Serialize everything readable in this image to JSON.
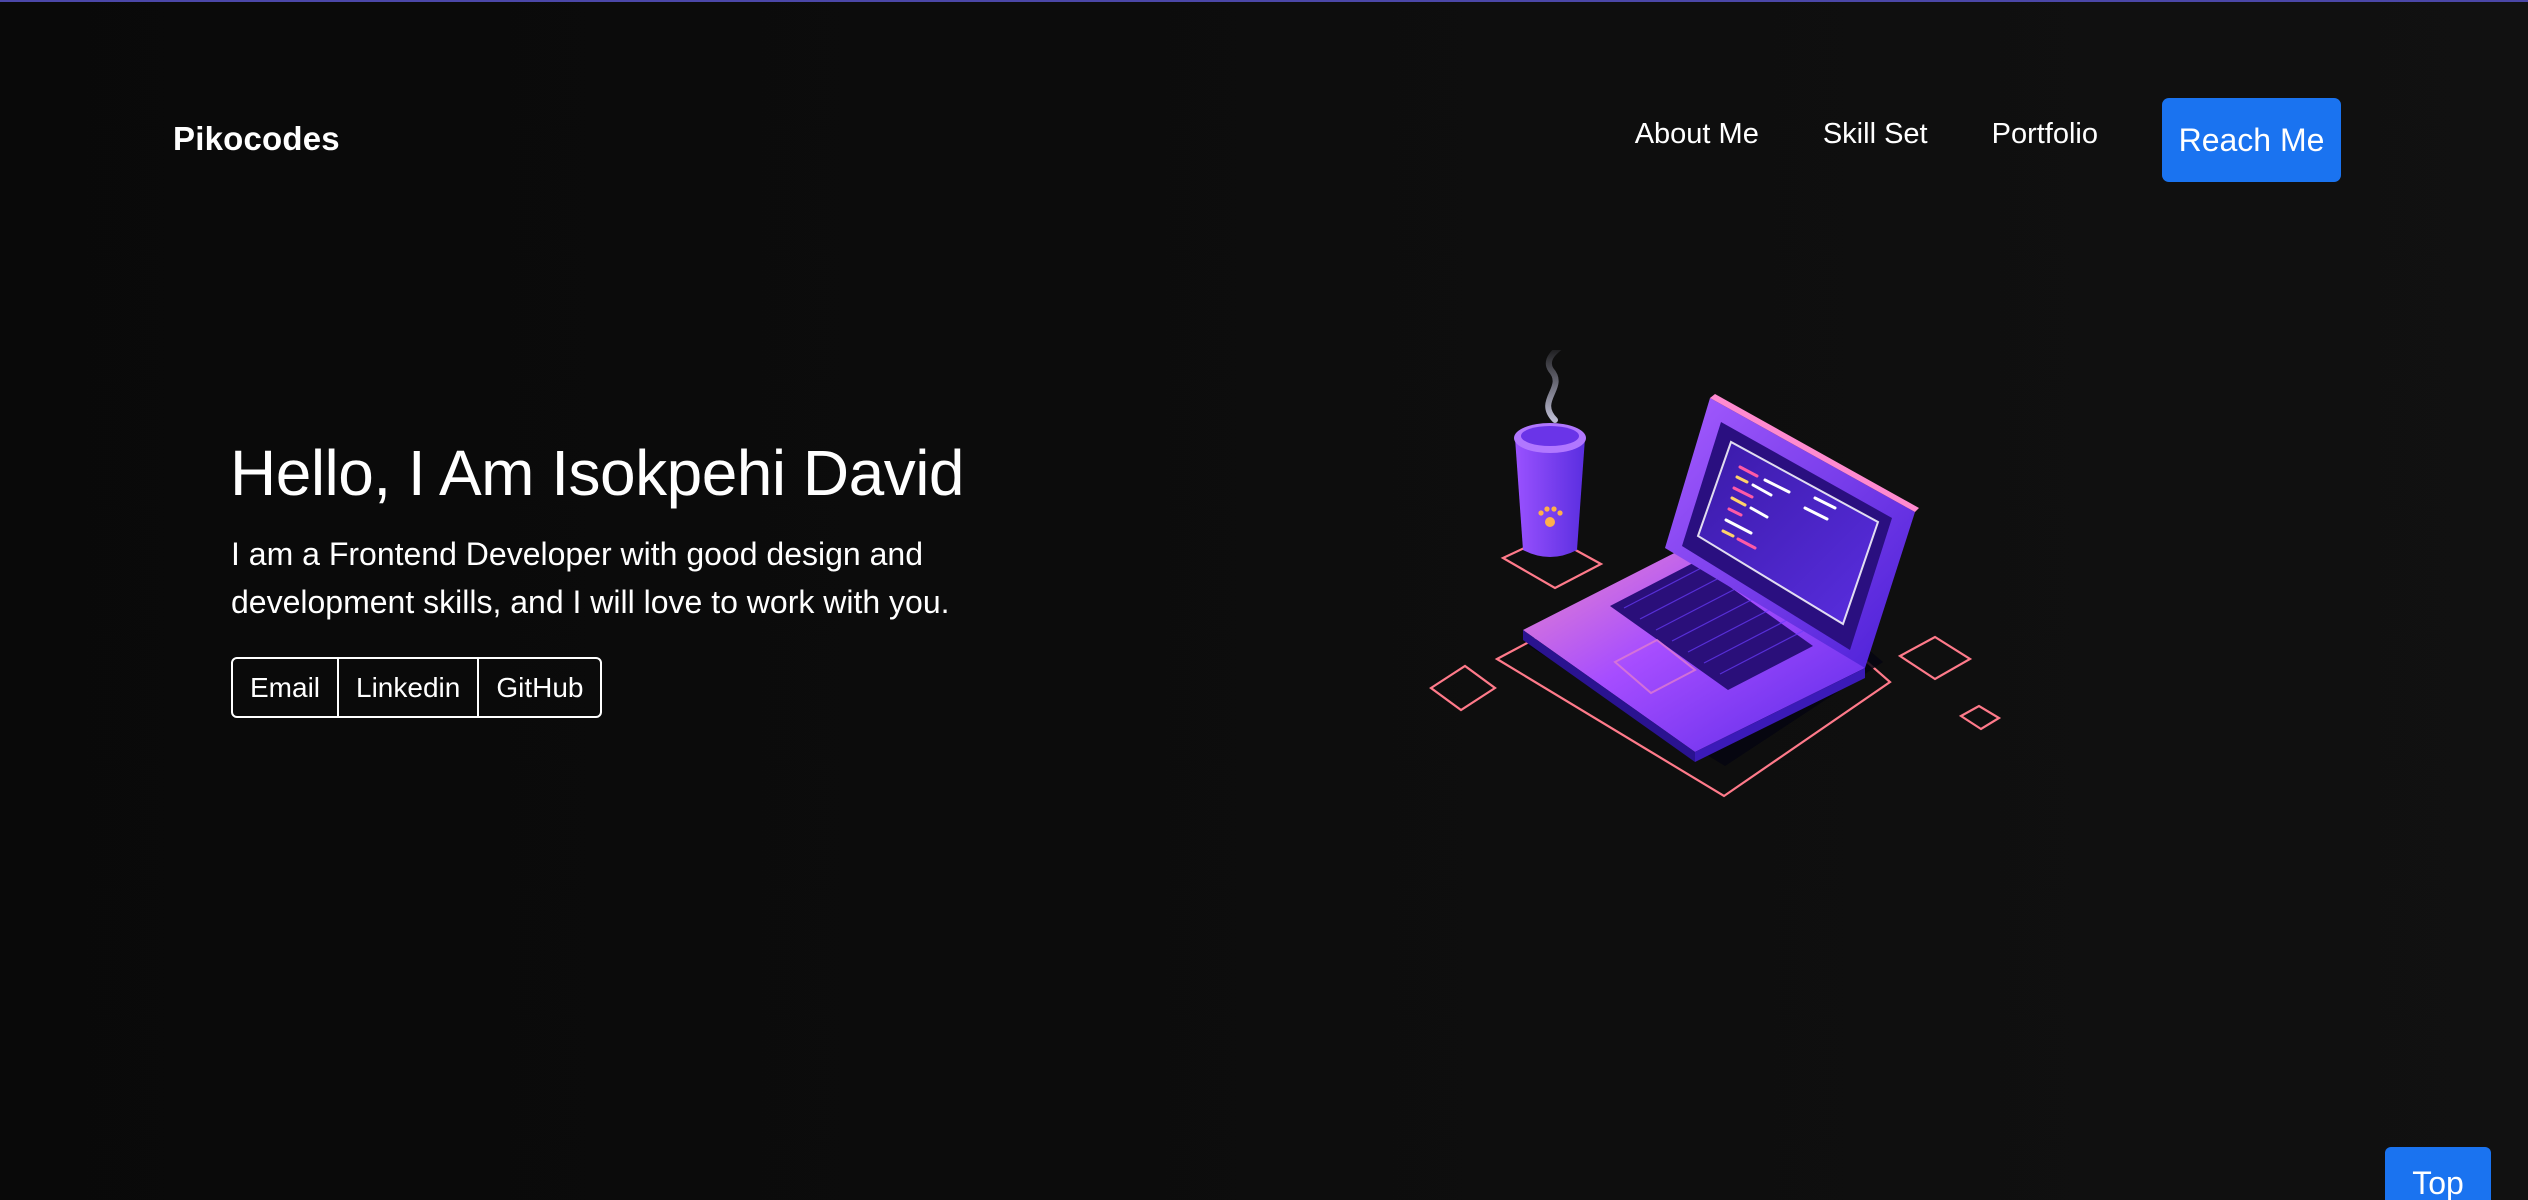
{
  "header": {
    "brand": "Pikocodes",
    "nav": {
      "about": "About Me",
      "skills": "Skill Set",
      "portfolio": "Portfolio"
    },
    "cta": "Reach Me"
  },
  "hero": {
    "title": "Hello, I Am Isokpehi David",
    "description": "I am a Frontend Developer with good design and development skills, and I will love to work with you.",
    "links": {
      "email": "Email",
      "linkedin": "Linkedin",
      "github": "GitHub"
    },
    "illustration_icon": "laptop-coffee-illustration"
  },
  "scroll_top": "Top",
  "colors": {
    "accent": "#1a73f0",
    "background": "#0b0b0b",
    "text": "#ffffff",
    "illustration_purple": "#7b2ff7",
    "illustration_coral": "#ff7a7a"
  }
}
